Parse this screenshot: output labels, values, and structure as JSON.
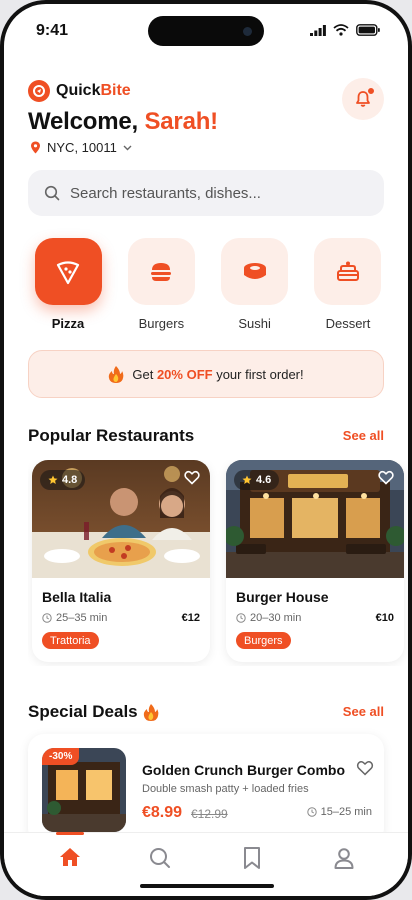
{
  "status": {
    "time": "9:41"
  },
  "brand": {
    "name_part1": "Quick",
    "name_part2": "Bite"
  },
  "header": {
    "welcome_prefix": "Welcome,",
    "user_name": "Sarah!",
    "location": "NYC, 10011"
  },
  "search": {
    "placeholder": "Search restaurants, dishes..."
  },
  "categories": [
    {
      "label": "Pizza",
      "icon": "pizza-icon",
      "active": true
    },
    {
      "label": "Burgers",
      "icon": "burger-icon",
      "active": false
    },
    {
      "label": "Sushi",
      "icon": "sushi-icon",
      "active": false
    },
    {
      "label": "Dessert",
      "icon": "dessert-icon",
      "active": false
    }
  ],
  "promo": {
    "prefix": "Get",
    "highlight": "20% OFF",
    "suffix": "your first order!"
  },
  "popular": {
    "title": "Popular Restaurants",
    "see_all": "See all",
    "items": [
      {
        "rating": "4.8",
        "name": "Bella Italia",
        "time": "25–35 min",
        "price": "€12",
        "tag": "Trattoria"
      },
      {
        "rating": "4.6",
        "name": "Burger House",
        "time": "20–30 min",
        "price": "€10",
        "tag": "Burgers"
      }
    ]
  },
  "deals": {
    "title": "Special Deals",
    "see_all": "See all",
    "item": {
      "badge": "-30%",
      "title": "Golden Crunch Burger Combo",
      "subtitle": "Double smash patty + loaded fries",
      "price": "€8.99",
      "old_price": "€12.99",
      "time": "15–25 min"
    }
  },
  "colors": {
    "accent": "#ef4f24",
    "accent_soft": "#fdeee8",
    "text": "#111111"
  }
}
